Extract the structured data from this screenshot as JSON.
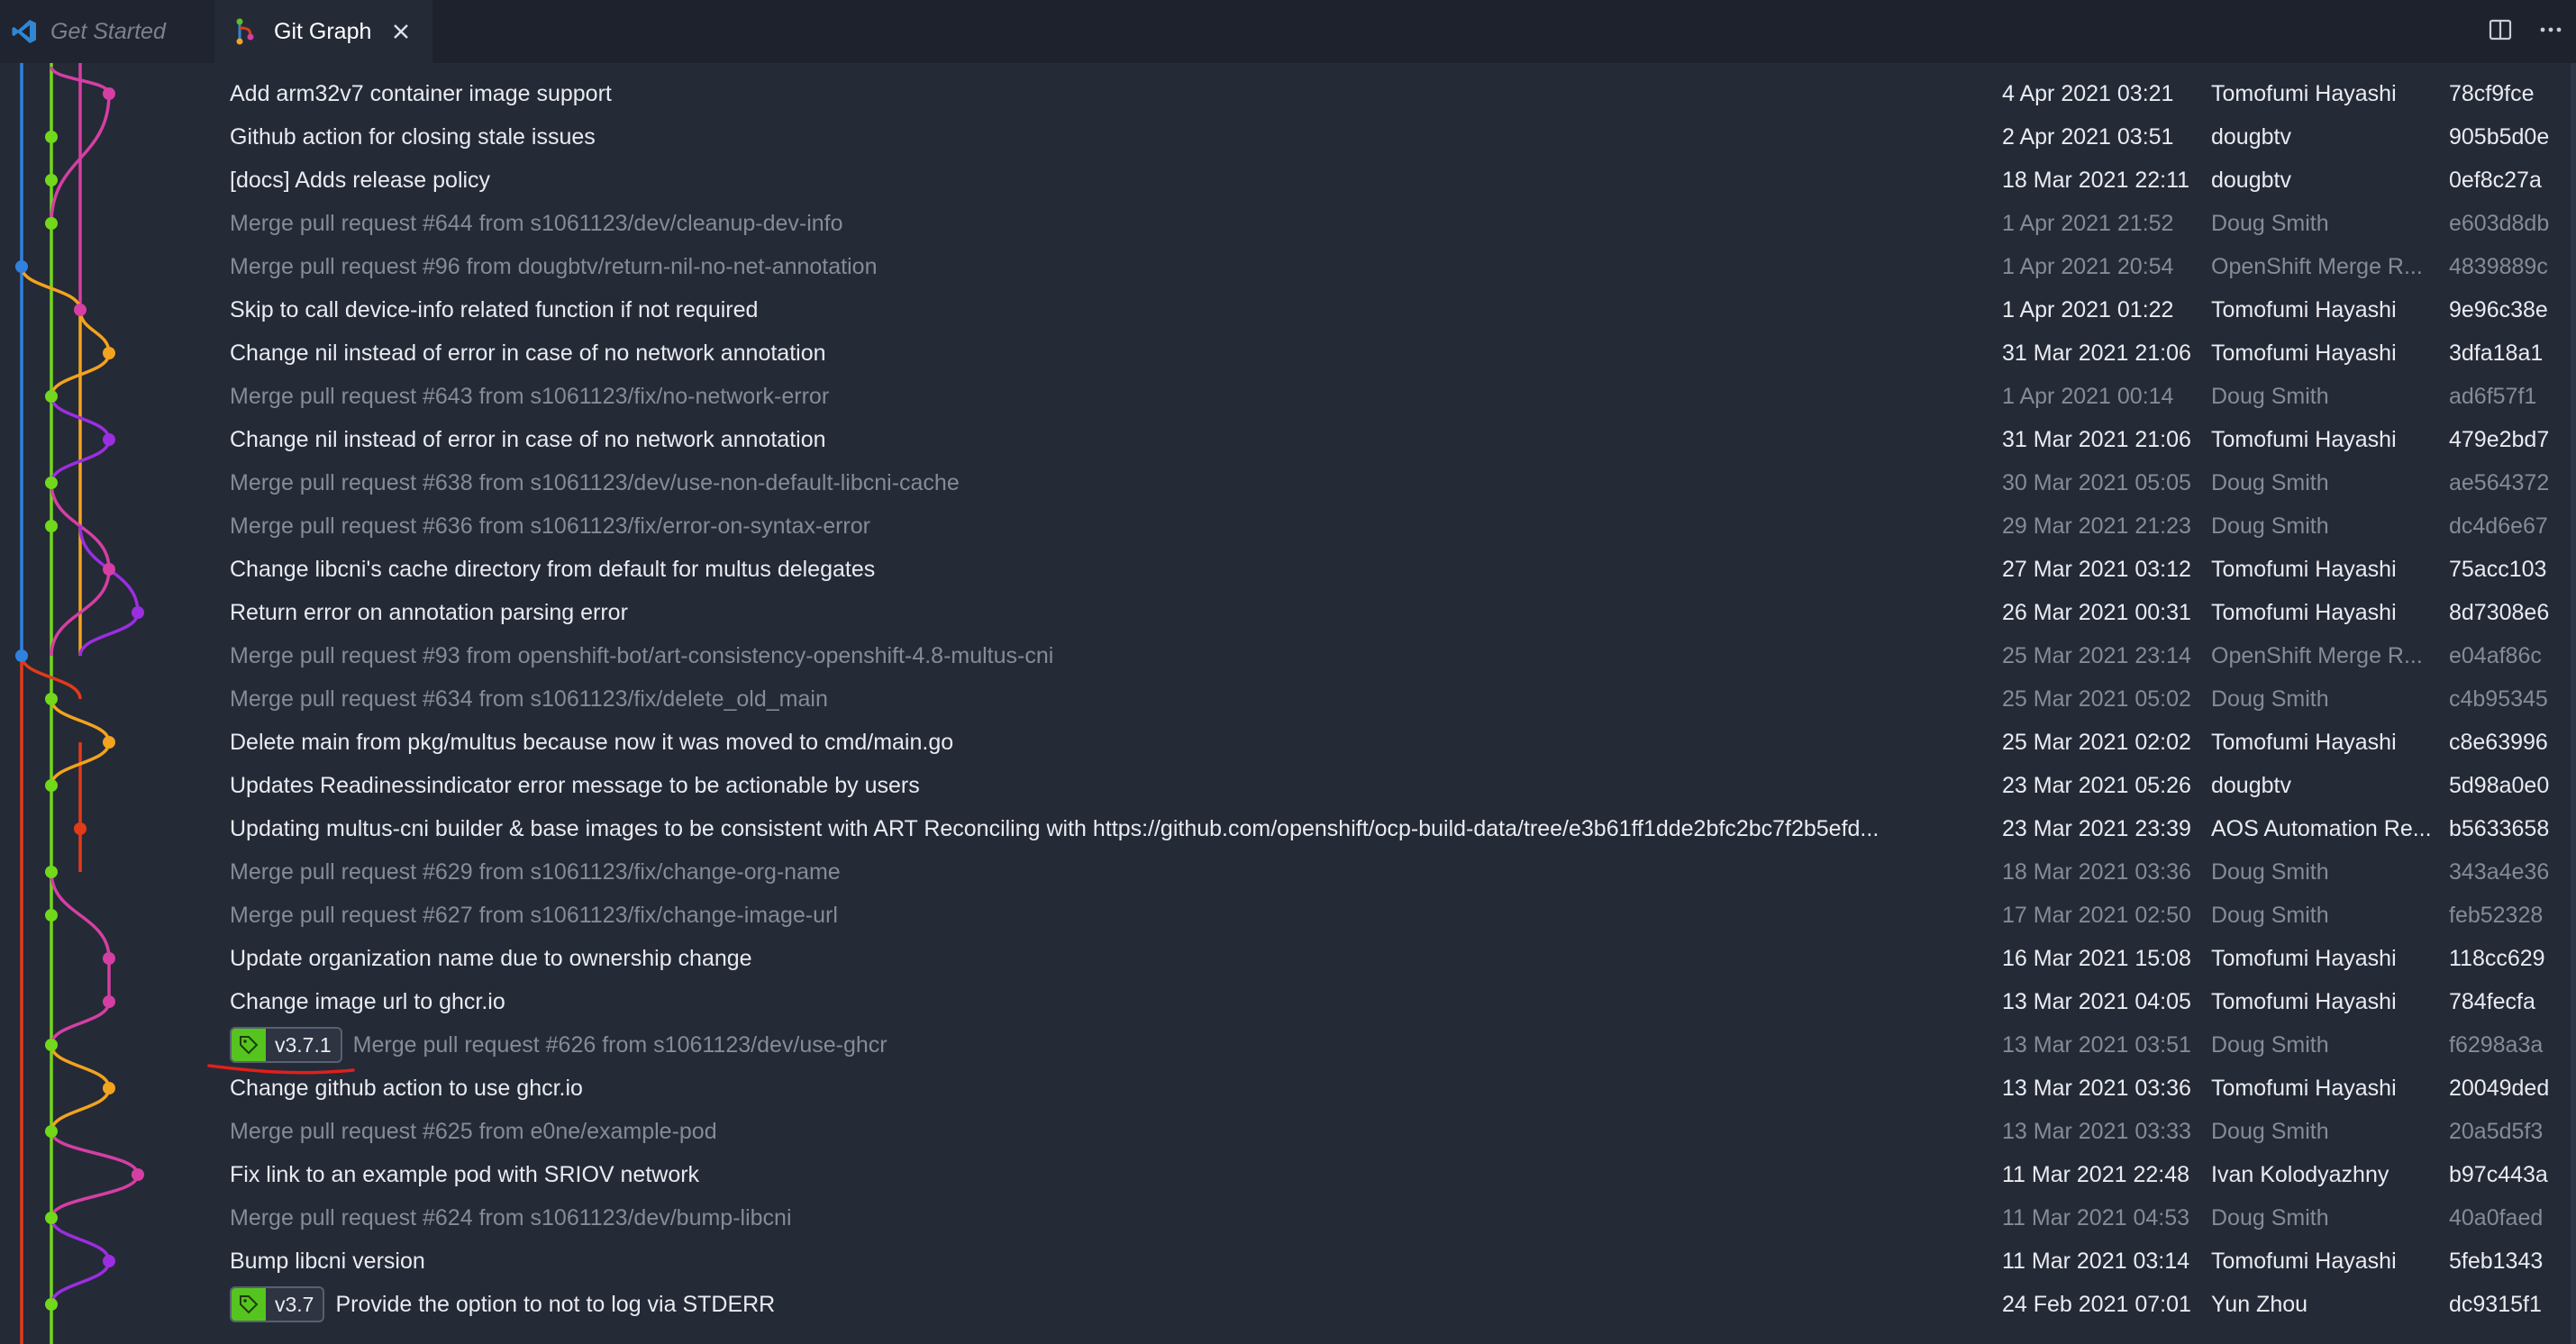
{
  "tabs": [
    {
      "label": "Get Started",
      "icon": "vscode-logo-icon"
    },
    {
      "label": "Git Graph",
      "icon": "git-graph-icon",
      "active": true
    }
  ],
  "tab_actions": [
    "split-editor-icon",
    "more-actions-icon"
  ],
  "colors": {
    "background": "#252a37",
    "tabbar": "#1d222d",
    "text": "#e9ebf0",
    "merge_text": "#868b97",
    "tag_green": "#56c41f",
    "annotation_red": "#e0201c",
    "branches": [
      "#2f82e0",
      "#e23b18",
      "#f3a31e",
      "#71d81c",
      "#d53fa3",
      "#9b2ee1"
    ]
  },
  "commits": [
    {
      "message": "Add arm32v7 container image support",
      "date": "4 Apr 2021 03:21",
      "author": "Tomofumi Hayashi",
      "hash": "78cf9fce",
      "merge": false
    },
    {
      "message": "Github action for closing stale issues",
      "date": "2 Apr 2021 03:51",
      "author": "dougbtv",
      "hash": "905b5d0e",
      "merge": false
    },
    {
      "message": "[docs] Adds release policy",
      "date": "18 Mar 2021 22:11",
      "author": "dougbtv",
      "hash": "0ef8c27a",
      "merge": false
    },
    {
      "message": "Merge pull request #644 from s1061123/dev/cleanup-dev-info",
      "date": "1 Apr 2021 21:52",
      "author": "Doug Smith",
      "hash": "e603d8db",
      "merge": true
    },
    {
      "message": "Merge pull request #96 from dougbtv/return-nil-no-net-annotation",
      "date": "1 Apr 2021 20:54",
      "author": "OpenShift Merge R...",
      "hash": "4839889c",
      "merge": true
    },
    {
      "message": "Skip to call device-info related function if not required",
      "date": "1 Apr 2021 01:22",
      "author": "Tomofumi Hayashi",
      "hash": "9e96c38e",
      "merge": false
    },
    {
      "message": "Change nil instead of error in case of no network annotation",
      "date": "31 Mar 2021 21:06",
      "author": "Tomofumi Hayashi",
      "hash": "3dfa18a1",
      "merge": false
    },
    {
      "message": "Merge pull request #643 from s1061123/fix/no-network-error",
      "date": "1 Apr 2021 00:14",
      "author": "Doug Smith",
      "hash": "ad6f57f1",
      "merge": true
    },
    {
      "message": "Change nil instead of error in case of no network annotation",
      "date": "31 Mar 2021 21:06",
      "author": "Tomofumi Hayashi",
      "hash": "479e2bd7",
      "merge": false
    },
    {
      "message": "Merge pull request #638 from s1061123/dev/use-non-default-libcni-cache",
      "date": "30 Mar 2021 05:05",
      "author": "Doug Smith",
      "hash": "ae564372",
      "merge": true
    },
    {
      "message": "Merge pull request #636 from s1061123/fix/error-on-syntax-error",
      "date": "29 Mar 2021 21:23",
      "author": "Doug Smith",
      "hash": "dc4d6e67",
      "merge": true
    },
    {
      "message": "Change libcni's cache directory from default for multus delegates",
      "date": "27 Mar 2021 03:12",
      "author": "Tomofumi Hayashi",
      "hash": "75acc103",
      "merge": false
    },
    {
      "message": "Return error on annotation parsing error",
      "date": "26 Mar 2021 00:31",
      "author": "Tomofumi Hayashi",
      "hash": "8d7308e6",
      "merge": false
    },
    {
      "message": "Merge pull request #93 from openshift-bot/art-consistency-openshift-4.8-multus-cni",
      "date": "25 Mar 2021 23:14",
      "author": "OpenShift Merge R...",
      "hash": "e04af86c",
      "merge": true
    },
    {
      "message": "Merge pull request #634 from s1061123/fix/delete_old_main",
      "date": "25 Mar 2021 05:02",
      "author": "Doug Smith",
      "hash": "c4b95345",
      "merge": true
    },
    {
      "message": "Delete main from pkg/multus because now it was moved to cmd/main.go",
      "date": "25 Mar 2021 02:02",
      "author": "Tomofumi Hayashi",
      "hash": "c8e63996",
      "merge": false
    },
    {
      "message": "Updates Readinessindicator error message to be actionable by users",
      "date": "23 Mar 2021 05:26",
      "author": "dougbtv",
      "hash": "5d98a0e0",
      "merge": false
    },
    {
      "message": "Updating multus-cni builder & base images to be consistent with ART Reconciling with https://github.com/openshift/ocp-build-data/tree/e3b61ff1dde2bfc2bc7f2b5efd...",
      "date": "23 Mar 2021 23:39",
      "author": "AOS Automation Re...",
      "hash": "b5633658",
      "merge": false
    },
    {
      "message": "Merge pull request #629 from s1061123/fix/change-org-name",
      "date": "18 Mar 2021 03:36",
      "author": "Doug Smith",
      "hash": "343a4e36",
      "merge": true
    },
    {
      "message": "Merge pull request #627 from s1061123/fix/change-image-url",
      "date": "17 Mar 2021 02:50",
      "author": "Doug Smith",
      "hash": "feb52328",
      "merge": true
    },
    {
      "message": "Update organization name due to ownership change",
      "date": "16 Mar 2021 15:08",
      "author": "Tomofumi Hayashi",
      "hash": "118cc629",
      "merge": false
    },
    {
      "message": "Change image url to ghcr.io",
      "date": "13 Mar 2021 04:05",
      "author": "Tomofumi Hayashi",
      "hash": "784fecfa",
      "merge": false
    },
    {
      "message": "Merge pull request #626 from s1061123/dev/use-ghcr",
      "date": "13 Mar 2021 03:51",
      "author": "Doug Smith",
      "hash": "f6298a3a",
      "merge": true,
      "tag": "v3.7.1"
    },
    {
      "message": "Change github action to use ghcr.io",
      "date": "13 Mar 2021 03:36",
      "author": "Tomofumi Hayashi",
      "hash": "20049ded",
      "merge": false
    },
    {
      "message": "Merge pull request #625 from e0ne/example-pod",
      "date": "13 Mar 2021 03:33",
      "author": "Doug Smith",
      "hash": "20a5d5f3",
      "merge": true
    },
    {
      "message": "Fix link to an example pod with SRIOV network",
      "date": "11 Mar 2021 22:48",
      "author": "Ivan Kolodyazhny",
      "hash": "b97c443a",
      "merge": false
    },
    {
      "message": "Merge pull request #624 from s1061123/dev/bump-libcni",
      "date": "11 Mar 2021 04:53",
      "author": "Doug Smith",
      "hash": "40a0faed",
      "merge": true
    },
    {
      "message": "Bump libcni version",
      "date": "11 Mar 2021 03:14",
      "author": "Tomofumi Hayashi",
      "hash": "5feb1343",
      "merge": false
    },
    {
      "message": "Provide the option to not to log via STDERR",
      "date": "24 Feb 2021 07:01",
      "author": "Yun Zhou",
      "hash": "dc9315f1",
      "merge": false,
      "tag": "v3.7"
    }
  ],
  "graph_nodes": [
    {
      "lane": 3,
      "color": 4,
      "hollow": false
    },
    {
      "lane": 1,
      "color": 3,
      "hollow": false
    },
    {
      "lane": 1,
      "color": 3,
      "hollow": false
    },
    {
      "lane": 1,
      "color": 3,
      "hollow": false
    },
    {
      "lane": 0,
      "color": 0,
      "hollow": false
    },
    {
      "lane": 2,
      "color": 4,
      "hollow": false
    },
    {
      "lane": 3,
      "color": 2,
      "hollow": false
    },
    {
      "lane": 1,
      "color": 3,
      "hollow": false
    },
    {
      "lane": 3,
      "color": 5,
      "hollow": false
    },
    {
      "lane": 1,
      "color": 3,
      "hollow": false
    },
    {
      "lane": 1,
      "color": 3,
      "hollow": false
    },
    {
      "lane": 3,
      "color": 4,
      "hollow": false
    },
    {
      "lane": 4,
      "color": 5,
      "hollow": false
    },
    {
      "lane": 0,
      "color": 0,
      "hollow": false
    },
    {
      "lane": 1,
      "color": 3,
      "hollow": false
    },
    {
      "lane": 3,
      "color": 2,
      "hollow": false
    },
    {
      "lane": 1,
      "color": 3,
      "hollow": false
    },
    {
      "lane": 2,
      "color": 1,
      "hollow": false
    },
    {
      "lane": 1,
      "color": 3,
      "hollow": false
    },
    {
      "lane": 1,
      "color": 3,
      "hollow": false
    },
    {
      "lane": 3,
      "color": 4,
      "hollow": false
    },
    {
      "lane": 3,
      "color": 4,
      "hollow": false
    },
    {
      "lane": 1,
      "color": 3,
      "hollow": false
    },
    {
      "lane": 3,
      "color": 2,
      "hollow": false
    },
    {
      "lane": 1,
      "color": 3,
      "hollow": false
    },
    {
      "lane": 4,
      "color": 4,
      "hollow": false
    },
    {
      "lane": 1,
      "color": 3,
      "hollow": false
    },
    {
      "lane": 3,
      "color": 5,
      "hollow": false
    },
    {
      "lane": 1,
      "color": 3,
      "hollow": false
    }
  ]
}
